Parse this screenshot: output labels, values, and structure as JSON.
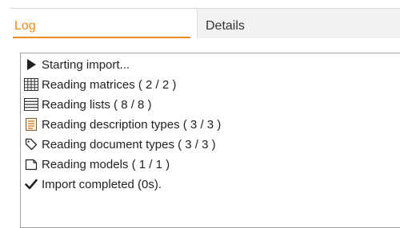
{
  "tabs": [
    {
      "label": "Log",
      "active": true
    },
    {
      "label": "Details",
      "active": false
    }
  ],
  "accent_color": "#f08a1c",
  "log": [
    {
      "icon": "play-icon",
      "text": "Starting import..."
    },
    {
      "icon": "matrix-grid-icon",
      "text": "Reading matrices ( 2 / 2 )"
    },
    {
      "icon": "list-icon",
      "text": "Reading lists ( 8 / 8 )"
    },
    {
      "icon": "description-type-icon",
      "text": "Reading description types ( 3 / 3 )"
    },
    {
      "icon": "tag-icon",
      "text": "Reading document types ( 3 / 3 )"
    },
    {
      "icon": "document-icon",
      "text": "Reading models ( 1 / 1 )"
    },
    {
      "icon": "checkmark-icon",
      "text": "Import completed (0s)."
    }
  ]
}
